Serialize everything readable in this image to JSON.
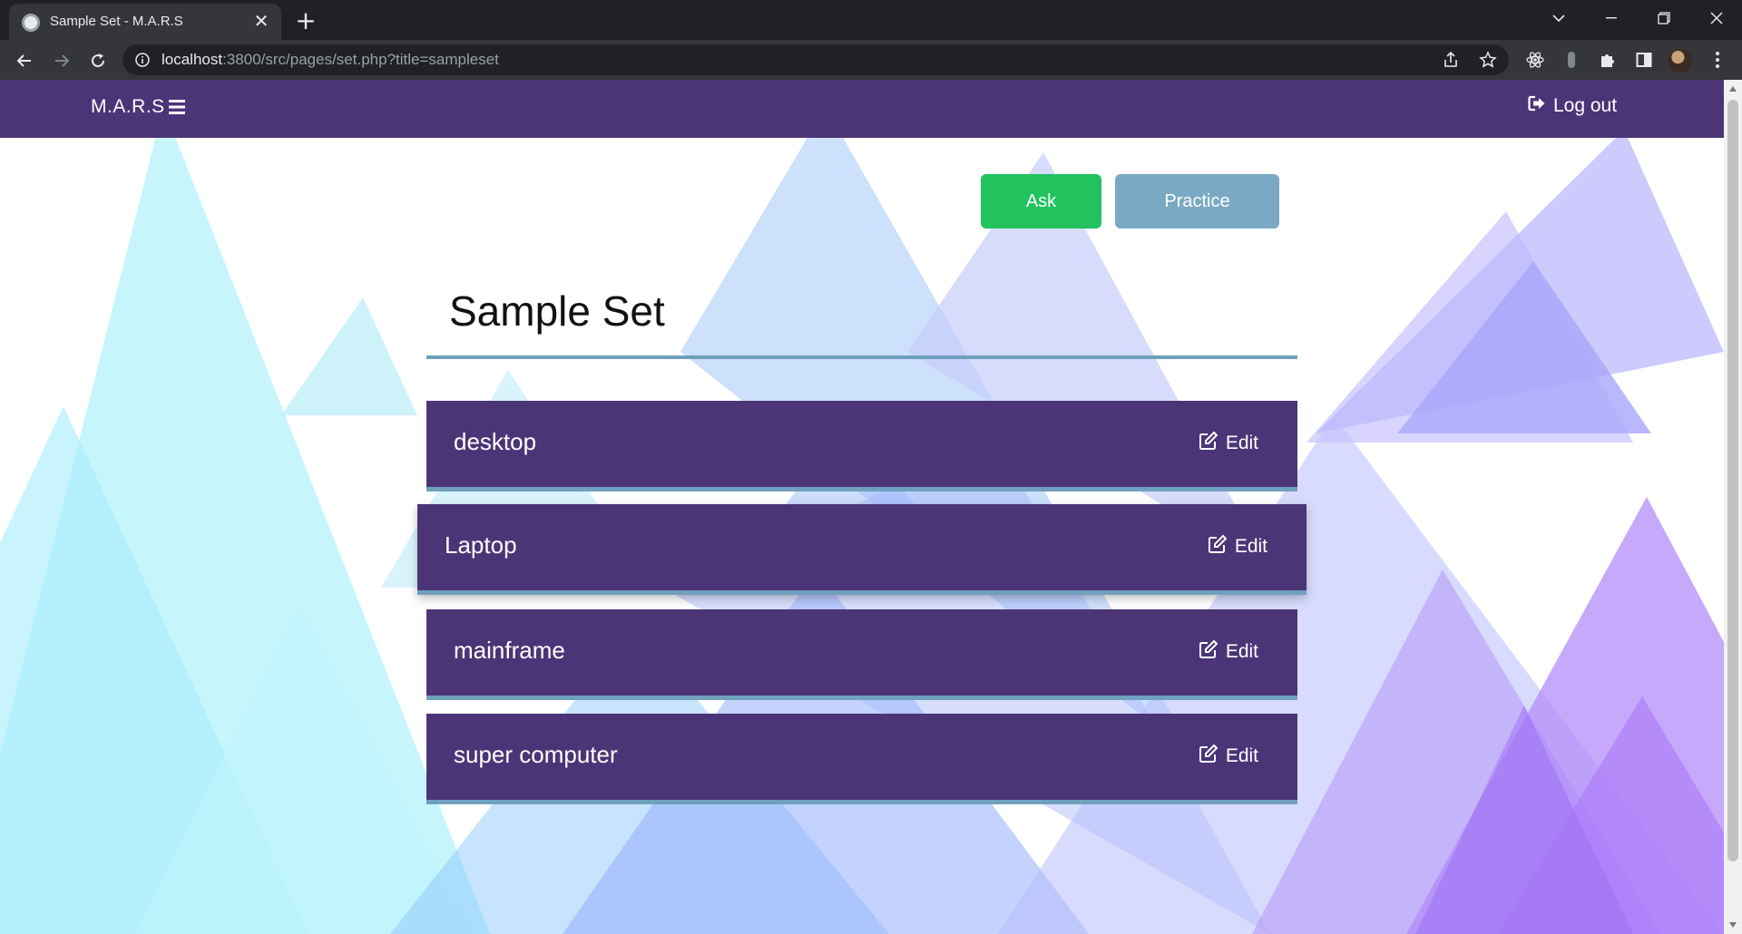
{
  "browser": {
    "tab_title": "Sample Set - M.A.R.S",
    "url_host": "localhost",
    "url_rest": ":3800/src/pages/set.php?title=sampleset"
  },
  "navbar": {
    "brand": "M.A.R.S",
    "logout_label": "Log out"
  },
  "actions": {
    "ask_label": "Ask",
    "practice_label": "Practice"
  },
  "set": {
    "title": "Sample Set",
    "cards": [
      {
        "term": "desktop",
        "edit_label": "Edit"
      },
      {
        "term": "Laptop",
        "edit_label": "Edit"
      },
      {
        "term": "mainframe",
        "edit_label": "Edit"
      },
      {
        "term": "super computer",
        "edit_label": "Edit"
      }
    ]
  },
  "colors": {
    "navbar": "#4b3577",
    "ask_button": "#22c35e",
    "practice_button": "#7aa9c4",
    "card_border": "#6fa0bd"
  },
  "icons": [
    "menu-icon",
    "logout-icon",
    "edit-icon"
  ]
}
